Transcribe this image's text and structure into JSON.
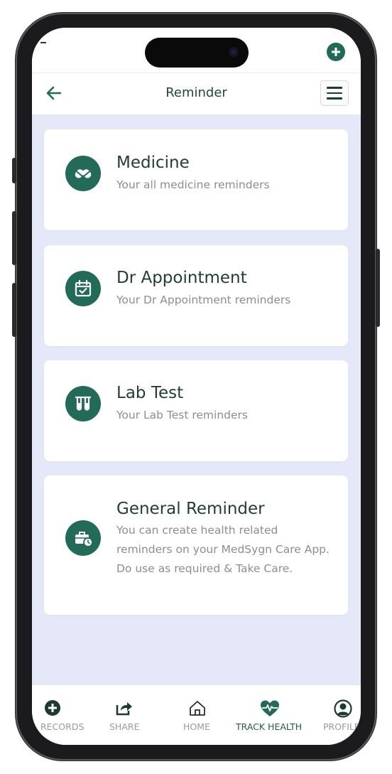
{
  "header": {
    "title": "Reminder"
  },
  "reminders": [
    {
      "title": "Medicine",
      "subtitle": "Your all medicine reminders",
      "icon": "pills-icon"
    },
    {
      "title": "Dr Appointment",
      "subtitle": "Your Dr Appointment reminders",
      "icon": "calendar-check-icon"
    },
    {
      "title": "Lab Test",
      "subtitle": "Your Lab Test reminders",
      "icon": "test-tubes-icon"
    },
    {
      "title": "General Reminder",
      "subtitle": "You can create health related reminders on your MedSygn Care App. Do use as required & Take Care.",
      "icon": "briefcase-clock-icon"
    }
  ],
  "nav": [
    {
      "label": "RECORDS",
      "icon": "plus-circle-icon"
    },
    {
      "label": "SHARE",
      "icon": "share-icon"
    },
    {
      "label": "HOME",
      "icon": "home-icon"
    },
    {
      "label": "TRACK HEALTH",
      "icon": "heart-pulse-icon",
      "active": true
    },
    {
      "label": "PROFILE",
      "icon": "profile-icon"
    }
  ],
  "colors": {
    "accent": "#226b59",
    "background": "#e4e8f8",
    "title": "#1e3e35",
    "subtitle": "#8d8d8d"
  }
}
